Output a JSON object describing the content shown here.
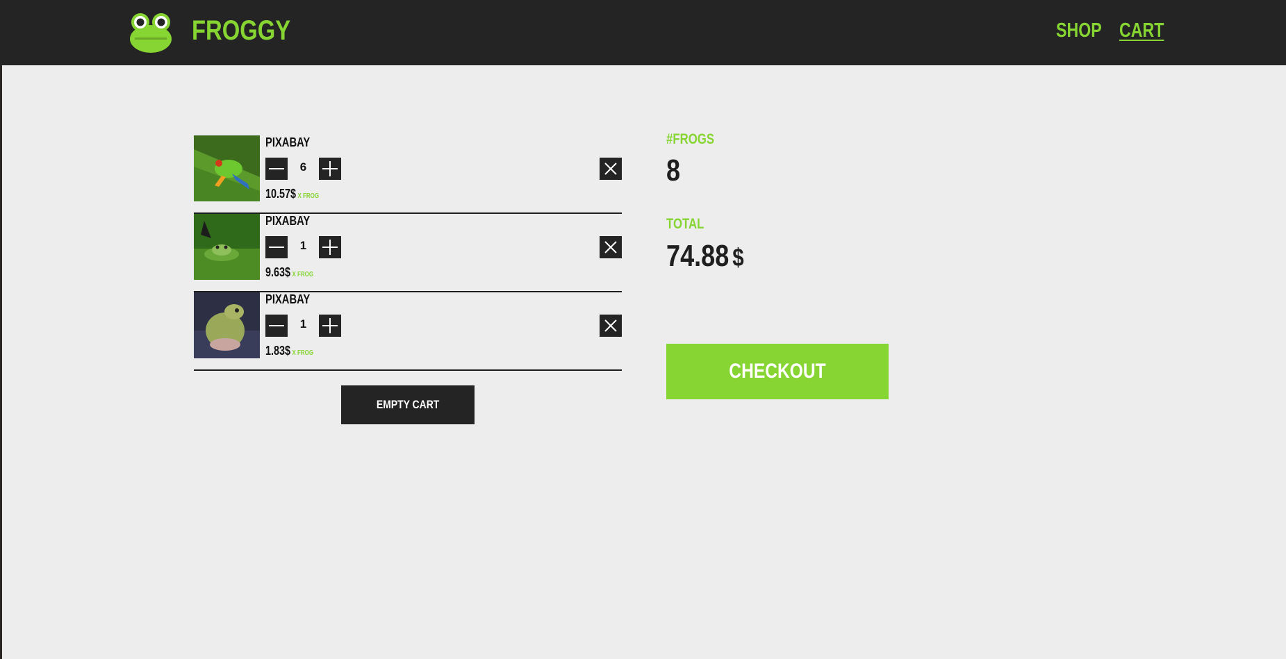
{
  "header": {
    "brand": "FROGGY",
    "nav": {
      "shop": "SHOP",
      "cart": "CART"
    }
  },
  "cart": {
    "items": [
      {
        "seller": "PIXABAY",
        "quantity": "6",
        "price": "10.57$",
        "per_unit": "X FROG",
        "image": "red-eyed-tree-frog-photo"
      },
      {
        "seller": "PIXABAY",
        "quantity": "1",
        "price": "9.63$",
        "per_unit": "X FROG",
        "image": "frog-in-water-photo"
      },
      {
        "seller": "PIXABAY",
        "quantity": "1",
        "price": "1.83$",
        "per_unit": "X FROG",
        "image": "tree-frog-on-blue-photo"
      }
    ],
    "empty_cart_label": "EMPTY CART"
  },
  "summary": {
    "frogs_label": "#FROGS",
    "frogs_count": "8",
    "total_label": "TOTAL",
    "total_value": "74.88",
    "currency": "$",
    "checkout_label": "CHECKOUT"
  },
  "colors": {
    "accent": "#86d532",
    "dark": "#242424",
    "background": "#ededed"
  }
}
